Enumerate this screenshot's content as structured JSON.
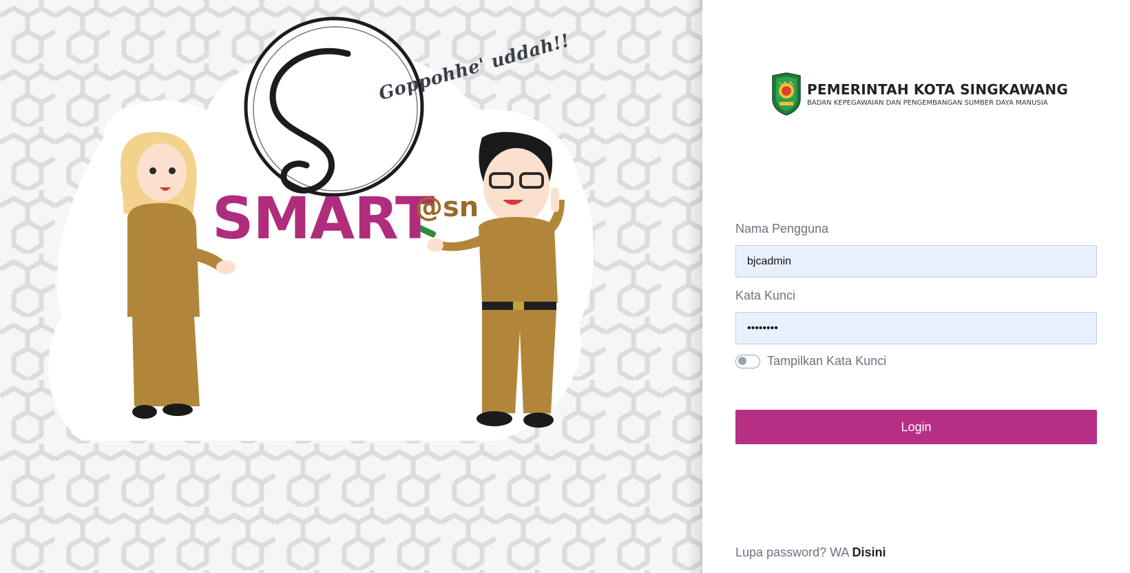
{
  "hero": {
    "tagline": "Goppohhe' uddah!!",
    "logo_monogram": "@sn",
    "brand_main": "SMART",
    "brand_suffix": "@sn",
    "accent_color": "#b02c7c",
    "suffix_color": "#9a6a2a"
  },
  "org": {
    "emblem_icon": "city-emblem-icon",
    "title": "PEMERINTAH KOTA SINGKAWANG",
    "subtitle": "BADAN KEPEGAWAIAN DAN PENGEMBANGAN SUMBER DAYA MANUSIA"
  },
  "form": {
    "username_label": "Nama Pengguna",
    "username_value": "bjcadmin",
    "password_label": "Kata Kunci",
    "password_value": "bjcadmin",
    "show_password_label": "Tampilkan Kata Kunci",
    "show_password_on": false,
    "login_label": "Login",
    "button_color": "#b62f84"
  },
  "footer": {
    "forgot_text": "Lupa password? WA",
    "forgot_link": "Disini"
  }
}
